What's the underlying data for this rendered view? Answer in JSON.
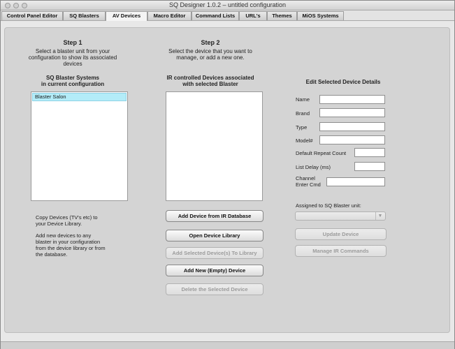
{
  "window": {
    "title": "SQ Designer 1.0.2 – untitled configuration"
  },
  "tabs": [
    {
      "label": "Control Panel Editor"
    },
    {
      "label": "SQ Blasters"
    },
    {
      "label": "AV Devices"
    },
    {
      "label": "Macro Editor"
    },
    {
      "label": "Command Lists"
    },
    {
      "label": "URL's"
    },
    {
      "label": "Themes"
    },
    {
      "label": "MiOS Systems"
    }
  ],
  "step1": {
    "heading": "Step 1",
    "desc": [
      "Select a blaster unit from your",
      "configuration to show its associated",
      "devices"
    ],
    "list_title": [
      "SQ Blaster Systems",
      "in current configuration"
    ],
    "items": [
      "Blaster Salon"
    ],
    "note1": [
      "Copy Devices (TV's etc) to",
      "your Device Library."
    ],
    "note2": [
      "Add new devices to any",
      "blaster in your configuration",
      "from the device library or from",
      "the database."
    ]
  },
  "step2": {
    "heading": "Step 2",
    "desc": [
      "Select the device that you want to",
      "manage, or add a new one."
    ],
    "list_title": [
      "IR controlled Devices associated",
      "with selected Blaster"
    ],
    "buttons": {
      "add_from_db": "Add Device from IR Database",
      "open_library": "Open Device Library",
      "add_to_library": "Add Selected Device(s) To Library",
      "add_new_empty": "Add New (Empty) Device",
      "delete_selected": "Delete the Selected Device"
    }
  },
  "details": {
    "heading": "Edit Selected Device Details",
    "fields": {
      "name": {
        "label": "Name",
        "value": ""
      },
      "brand": {
        "label": "Brand",
        "value": ""
      },
      "type": {
        "label": "Type",
        "value": ""
      },
      "model": {
        "label": "Model#",
        "value": ""
      },
      "repeat": {
        "label": "Default Repeat Count",
        "value": ""
      },
      "delay": {
        "label": "List Delay (ms)",
        "value": ""
      },
      "channel": {
        "label": [
          "Channel",
          "Enter Cmd"
        ],
        "value": ""
      }
    },
    "assigned_label": "Assigned to SQ Blaster unit:",
    "assigned_value": "",
    "update_button": "Update Device",
    "manage_button": "Manage IR Commands"
  },
  "colors": {
    "selection": "#b3ecf8",
    "panel": "#d4d4d4"
  }
}
